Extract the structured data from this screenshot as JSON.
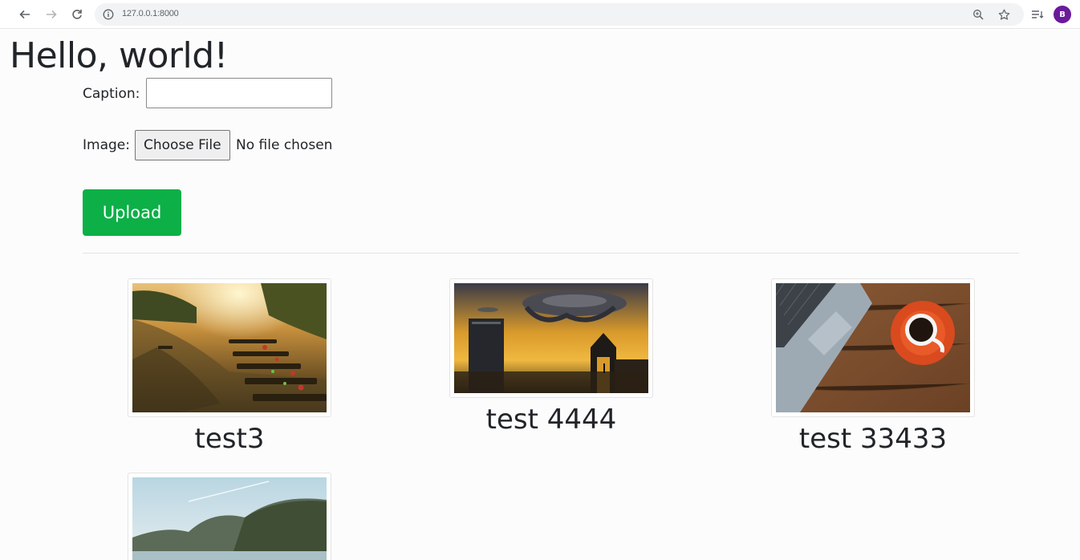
{
  "browser": {
    "url": "127.0.0.1:8000",
    "profile_initial": "B"
  },
  "page": {
    "title": "Hello, world!"
  },
  "form": {
    "caption_label": "Caption:",
    "caption_value": "",
    "image_label": "Image:",
    "choose_file_label": "Choose File",
    "no_file_text": "No file chosen",
    "upload_label": "Upload"
  },
  "gallery": {
    "items": [
      {
        "caption": "test3",
        "image": "river-boats-sunset"
      },
      {
        "caption": "test 4444",
        "image": "scifi-city-spaceship"
      },
      {
        "caption": "test 33433",
        "image": "laptop-coffee-desk"
      },
      {
        "caption": "",
        "image": "mountain-lake"
      }
    ]
  },
  "colors": {
    "upload_button": "#0cb047",
    "avatar": "#6a1b9a"
  }
}
